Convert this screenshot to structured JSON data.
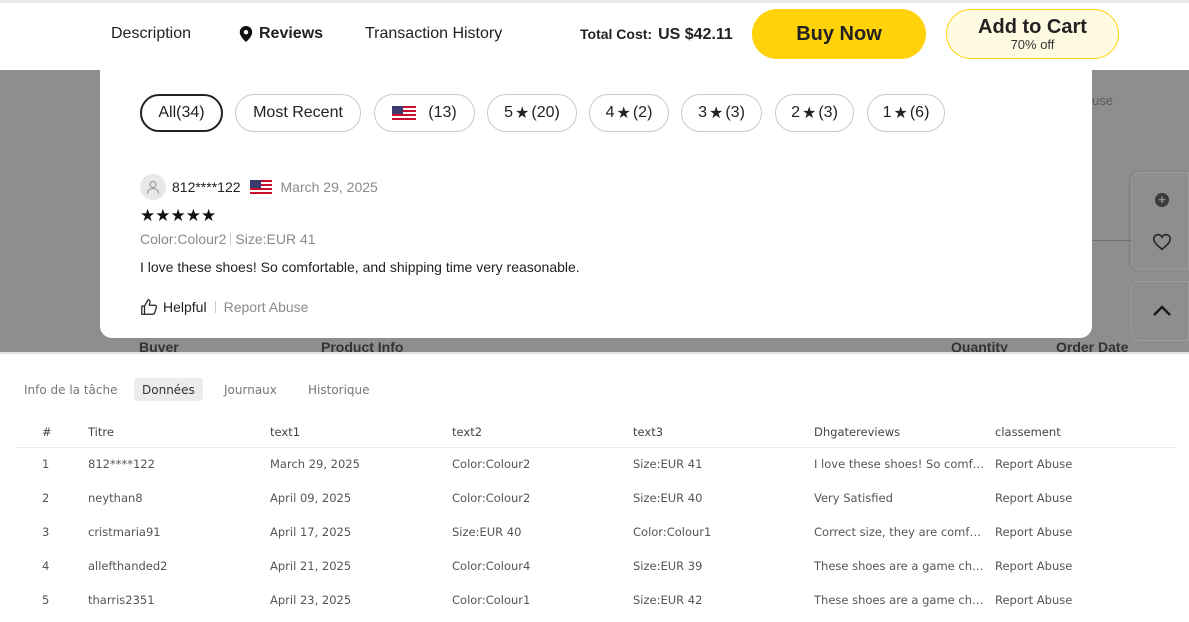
{
  "topbar": {
    "nav": [
      "Description",
      "Reviews",
      "Transaction History"
    ],
    "total_label": "Total Cost:",
    "total_value": "US $42.11",
    "buy_now": "Buy Now",
    "add_to_cart": "Add to Cart",
    "add_to_cart_sub": "70% off"
  },
  "background": {
    "partial_text": "use",
    "table_headers": [
      "Buyer",
      "Product Info",
      "Quantity",
      "Order Date"
    ]
  },
  "filters": [
    {
      "label": "All(34)",
      "active": true
    },
    {
      "label": "Most Recent"
    },
    {
      "label": "(13)",
      "flag": "us-flag"
    },
    {
      "prefix": "5",
      "count": "(20)"
    },
    {
      "prefix": "4",
      "count": "(2)"
    },
    {
      "prefix": "3",
      "count": "(3)"
    },
    {
      "prefix": "2",
      "count": "(3)"
    },
    {
      "prefix": "1",
      "count": "(6)"
    }
  ],
  "review": {
    "reviewer": "812****122",
    "date": "March 29, 2025",
    "stars": 5,
    "stars_text": "★★★★★",
    "color": "Color:Colour2",
    "size": "Size:EUR 41",
    "text": "I love these shoes! So comfortable, and shipping time very reasonable.",
    "helpful": "Helpful",
    "report": "Report Abuse"
  },
  "panel": {
    "tabs": [
      "Info de la tâche",
      "Données",
      "Journaux",
      "Historique"
    ],
    "active_tab": 1,
    "columns": [
      "#",
      "Titre",
      "text1",
      "text2",
      "text3",
      "Dhgatereviews",
      "classement"
    ],
    "rows": [
      [
        "1",
        "812****122",
        "March 29, 2025",
        "Color:Colour2",
        "Size:EUR 41",
        "I love these shoes! So comfo…",
        "Report Abuse"
      ],
      [
        "2",
        "neythan8",
        "April 09, 2025",
        "Color:Colour2",
        "Size:EUR 40",
        "Very Satisfied",
        "Report Abuse"
      ],
      [
        "3",
        "cristmaria91",
        "April 17, 2025",
        "Size:EUR 40",
        "Color:Colour1",
        "Correct size, they are comfor…",
        "Report Abuse"
      ],
      [
        "4",
        "allefthanded2",
        "April 21, 2025",
        "Color:Colour4",
        "Size:EUR 39",
        "These shoes are a game cha…",
        "Report Abuse"
      ],
      [
        "5",
        "tharris2351",
        "April 23, 2025",
        "Color:Colour1",
        "Size:EUR 42",
        "These shoes are a game cha…",
        "Report Abuse"
      ]
    ]
  }
}
